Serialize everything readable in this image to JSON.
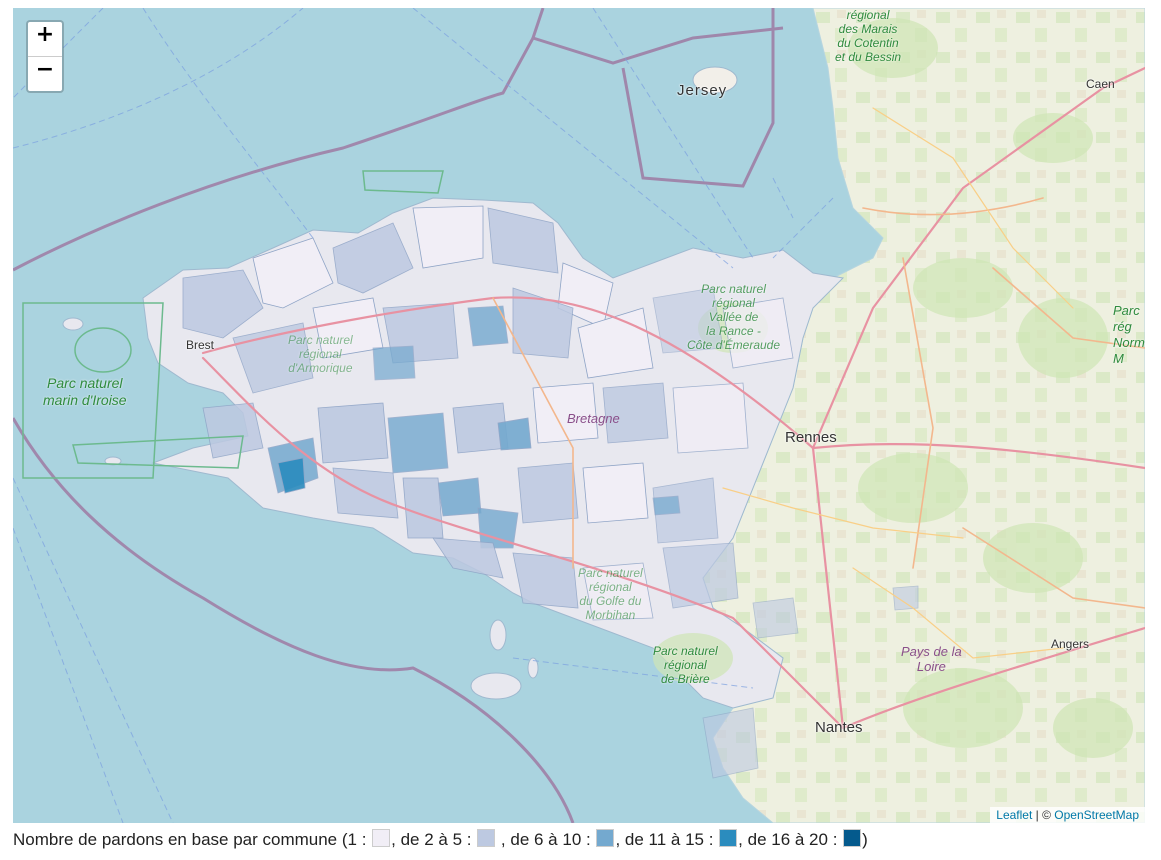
{
  "map": {
    "labels": {
      "jersey": "Jersey",
      "caen": "Caen",
      "brest": "Brest",
      "rennes": "Rennes",
      "nantes": "Nantes",
      "angers": "Angers",
      "bretagne": "Bretagne",
      "pays_de_la_loire_1": "Pays de la",
      "pays_de_la_loire_2": "Loire",
      "marais_1": "régional",
      "marais_2": "des Marais",
      "marais_3": "du Cotentin",
      "marais_4": "et du Bessin",
      "iroise_1": "Parc naturel",
      "iroise_2": "marin d'Iroise",
      "armorique_1": "Parc naturel",
      "armorique_2": "régional",
      "armorique_3": "d'Armorique",
      "rance_1": "Parc naturel",
      "rance_2": "régional",
      "rance_3": "Vallée de",
      "rance_4": "la Rance -",
      "rance_5": "Côte d'Émeraude",
      "morbihan_1": "Parc naturel",
      "morbihan_2": "régional",
      "morbihan_3": "du Golfe du",
      "morbihan_4": "Morbihan",
      "briere_1": "Parc naturel",
      "briere_2": "régional",
      "briere_3": "de Brière",
      "perche_1": "Parc",
      "perche_2": "rég",
      "perche_3": "Norm",
      "perche_4": "M"
    },
    "zoom_in": "+",
    "zoom_out": "−",
    "attribution": {
      "leaflet": "Leaflet",
      "separator": " | © ",
      "osm": "OpenStreetMap"
    }
  },
  "legend": {
    "prefix": "Nombre de pardons en base par commune (1 : ",
    "bins": [
      {
        "label": ", de 2 à 5 : ",
        "color": "#f1eef6"
      },
      {
        "label": " , de 6 à 10 : ",
        "color": "#bdc9e1"
      },
      {
        "label": ", de 11 à 15 : ",
        "color": "#74a9cf"
      },
      {
        "label": ", de 16 à 20 : ",
        "color": "#2b8cbe"
      },
      {
        "label": ")",
        "color": "#045a8d"
      }
    ]
  },
  "colors": {
    "sea": "#aad3df",
    "land": "#f2efe9",
    "green": "#dcebc9",
    "border": "#9e7fa6",
    "motorway": "#e892a2",
    "trunk": "#f3b78d"
  }
}
